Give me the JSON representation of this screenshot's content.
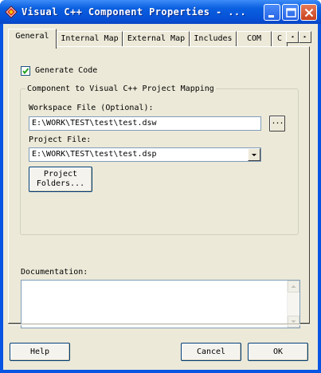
{
  "window": {
    "title": "Visual C++ Component Properties - ...",
    "icon": "visual-cpp-app-icon",
    "minimize_icon": "minimize-icon",
    "maximize_icon": "maximize-icon",
    "close_icon": "close-icon"
  },
  "tabs": [
    {
      "label": "General",
      "active": true
    },
    {
      "label": "Internal Map",
      "active": false
    },
    {
      "label": "External Map",
      "active": false
    },
    {
      "label": "Includes",
      "active": false
    },
    {
      "label": "COM",
      "active": false
    },
    {
      "label": "C",
      "active": false
    }
  ],
  "tab_scroll": {
    "left": "◂",
    "right": "▸"
  },
  "general": {
    "generate_code": {
      "label": "Generate Code",
      "checked": true
    },
    "mapping_group": {
      "title": "Component to Visual C++ Project Mapping",
      "workspace_label": "Workspace File (Optional):",
      "workspace_value": "E:\\WORK\\TEST\\test\\test.dsw",
      "browse_label": "...",
      "project_label": "Project File:",
      "project_value": "E:\\WORK\\TEST\\test\\test.dsp",
      "folders_button": [
        "Project",
        "Folders..."
      ]
    },
    "documentation": {
      "label": "Documentation:",
      "value": ""
    }
  },
  "footer": {
    "help": "Help",
    "cancel": "Cancel",
    "ok": "OK"
  },
  "colors": {
    "titlebar": "#0a5fe0",
    "dialog_face": "#ece9d8",
    "close_button": "#c8401c"
  }
}
